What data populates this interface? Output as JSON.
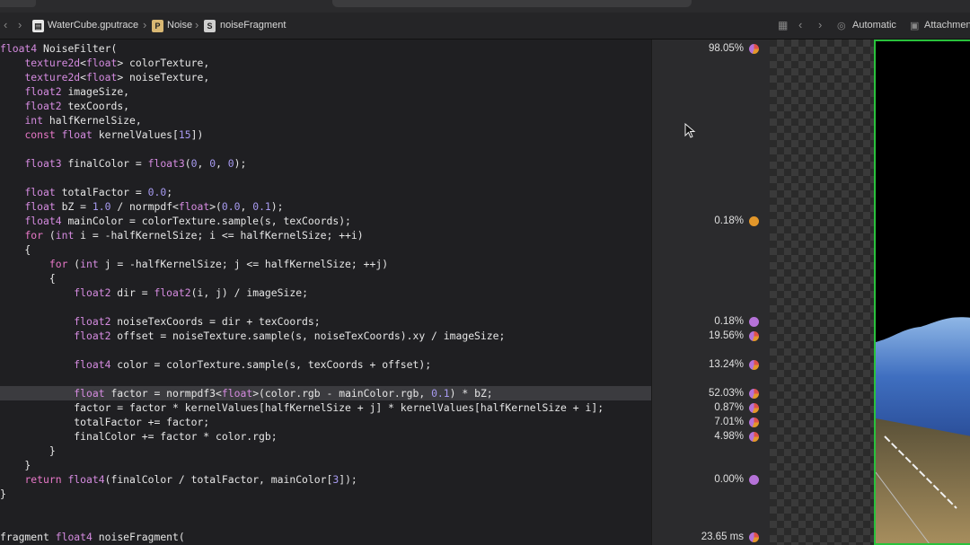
{
  "jumpbar": {
    "breadcrumbs": [
      "WaterCube.gputrace",
      "Noise",
      "noiseFragment"
    ],
    "mode": "Automatic",
    "attachments": "Attachmen"
  },
  "code_lines": [
    [
      [
        "kw-ty",
        "float4"
      ],
      [
        "fn",
        " NoiseFilter("
      ]
    ],
    [
      [
        "fn",
        "    "
      ],
      [
        "ty",
        "texture2d"
      ],
      [
        "fn",
        "<"
      ],
      [
        "ty",
        "float"
      ],
      [
        "fn",
        "> colorTexture,"
      ]
    ],
    [
      [
        "fn",
        "    "
      ],
      [
        "ty",
        "texture2d"
      ],
      [
        "fn",
        "<"
      ],
      [
        "ty",
        "float"
      ],
      [
        "fn",
        "> noiseTexture,"
      ]
    ],
    [
      [
        "fn",
        "    "
      ],
      [
        "ty",
        "float2"
      ],
      [
        "fn",
        " imageSize,"
      ]
    ],
    [
      [
        "fn",
        "    "
      ],
      [
        "ty",
        "float2"
      ],
      [
        "fn",
        " texCoords,"
      ]
    ],
    [
      [
        "fn",
        "    "
      ],
      [
        "ty",
        "int"
      ],
      [
        "fn",
        " halfKernelSize,"
      ]
    ],
    [
      [
        "fn",
        "    "
      ],
      [
        "kw",
        "const"
      ],
      [
        "fn",
        " "
      ],
      [
        "ty",
        "float"
      ],
      [
        "fn",
        " kernelValues["
      ],
      [
        "num",
        "15"
      ],
      [
        "fn",
        "])"
      ]
    ],
    [
      [
        "fn",
        ""
      ]
    ],
    [
      [
        "fn",
        "    "
      ],
      [
        "ty",
        "float3"
      ],
      [
        "fn",
        " finalColor = "
      ],
      [
        "ty",
        "float3"
      ],
      [
        "fn",
        "("
      ],
      [
        "num",
        "0"
      ],
      [
        "fn",
        ", "
      ],
      [
        "num",
        "0"
      ],
      [
        "fn",
        ", "
      ],
      [
        "num",
        "0"
      ],
      [
        "fn",
        ");"
      ]
    ],
    [
      [
        "fn",
        ""
      ]
    ],
    [
      [
        "fn",
        "    "
      ],
      [
        "ty",
        "float"
      ],
      [
        "fn",
        " totalFactor = "
      ],
      [
        "num",
        "0.0"
      ],
      [
        "fn",
        ";"
      ]
    ],
    [
      [
        "fn",
        "    "
      ],
      [
        "ty",
        "float"
      ],
      [
        "fn",
        " bZ = "
      ],
      [
        "num",
        "1.0"
      ],
      [
        "fn",
        " / normpdf<"
      ],
      [
        "ty",
        "float"
      ],
      [
        "fn",
        ">("
      ],
      [
        "num",
        "0.0"
      ],
      [
        "fn",
        ", "
      ],
      [
        "num",
        "0.1"
      ],
      [
        "fn",
        ");"
      ]
    ],
    [
      [
        "fn",
        "    "
      ],
      [
        "ty",
        "float4"
      ],
      [
        "fn",
        " mainColor = colorTexture.sample(s, texCoords);"
      ]
    ],
    [
      [
        "fn",
        "    "
      ],
      [
        "kw",
        "for"
      ],
      [
        "fn",
        " ("
      ],
      [
        "ty",
        "int"
      ],
      [
        "fn",
        " i = -halfKernelSize; i <= halfKernelSize; ++i)"
      ]
    ],
    [
      [
        "fn",
        "    {"
      ]
    ],
    [
      [
        "fn",
        "        "
      ],
      [
        "kw",
        "for"
      ],
      [
        "fn",
        " ("
      ],
      [
        "ty",
        "int"
      ],
      [
        "fn",
        " j = -halfKernelSize; j <= halfKernelSize; ++j)"
      ]
    ],
    [
      [
        "fn",
        "        {"
      ]
    ],
    [
      [
        "fn",
        "            "
      ],
      [
        "ty",
        "float2"
      ],
      [
        "fn",
        " dir = "
      ],
      [
        "ty",
        "float2"
      ],
      [
        "fn",
        "(i, j) / imageSize;"
      ]
    ],
    [
      [
        "fn",
        ""
      ]
    ],
    [
      [
        "fn",
        "            "
      ],
      [
        "ty",
        "float2"
      ],
      [
        "fn",
        " noiseTexCoords = dir + texCoords;"
      ]
    ],
    [
      [
        "fn",
        "            "
      ],
      [
        "ty",
        "float2"
      ],
      [
        "fn",
        " offset = noiseTexture.sample(s, noiseTexCoords).xy / imageSize;"
      ]
    ],
    [
      [
        "fn",
        ""
      ]
    ],
    [
      [
        "fn",
        "            "
      ],
      [
        "ty",
        "float4"
      ],
      [
        "fn",
        " color = colorTexture.sample(s, texCoords + offset);"
      ]
    ],
    [
      [
        "fn",
        ""
      ]
    ],
    [
      [
        "fn",
        "            "
      ],
      [
        "ty",
        "float"
      ],
      [
        "fn",
        " factor = normpdf3<"
      ],
      [
        "ty",
        "float"
      ],
      [
        "fn",
        ">(color.rgb - mainColor.rgb, "
      ],
      [
        "num",
        "0.1"
      ],
      [
        "fn",
        ") * bZ;"
      ]
    ],
    [
      [
        "fn",
        "            factor = factor * kernelValues[halfKernelSize + j] * kernelValues[halfKernelSize + i];"
      ]
    ],
    [
      [
        "fn",
        "            totalFactor += factor;"
      ]
    ],
    [
      [
        "fn",
        "            finalColor += factor * color.rgb;"
      ]
    ],
    [
      [
        "fn",
        "        }"
      ]
    ],
    [
      [
        "fn",
        "    }"
      ]
    ],
    [
      [
        "fn",
        "    "
      ],
      [
        "kw",
        "return"
      ],
      [
        "fn",
        " "
      ],
      [
        "ty",
        "float4"
      ],
      [
        "fn",
        "(finalColor / totalFactor, mainColor["
      ],
      [
        "num",
        "3"
      ],
      [
        "fn",
        "]);"
      ]
    ],
    [
      [
        "fn",
        "}"
      ]
    ],
    [
      [
        "fn",
        ""
      ]
    ],
    [
      [
        "fn",
        ""
      ]
    ],
    [
      [
        "fn",
        "fragment "
      ],
      [
        "ty",
        "float4"
      ],
      [
        "fn",
        " noiseFragment("
      ]
    ]
  ],
  "perf": [
    {
      "line": 0,
      "value": "98.05%",
      "pie": "multi"
    },
    {
      "line": 12,
      "value": "0.18%",
      "pie": "orange"
    },
    {
      "line": 19,
      "value": "0.18%",
      "pie": "purple"
    },
    {
      "line": 20,
      "value": "19.56%",
      "pie": "multi"
    },
    {
      "line": 22,
      "value": "13.24%",
      "pie": "multi"
    },
    {
      "line": 24,
      "value": "52.03%",
      "pie": "multi"
    },
    {
      "line": 25,
      "value": "0.87%",
      "pie": "multi"
    },
    {
      "line": 26,
      "value": "7.01%",
      "pie": "multi"
    },
    {
      "line": 27,
      "value": "4.98%",
      "pie": "multi"
    },
    {
      "line": 30,
      "value": "0.00%",
      "pie": "purple"
    },
    {
      "line": 34,
      "value": "23.65 ms",
      "pie": "multi"
    }
  ],
  "highlighted_line": 24,
  "colors": {
    "accent_green": "#29c13c",
    "keyword": "#e878c8",
    "number": "#a79af0",
    "pie_orange": "#e3972a",
    "pie_purple": "#b572d8"
  }
}
